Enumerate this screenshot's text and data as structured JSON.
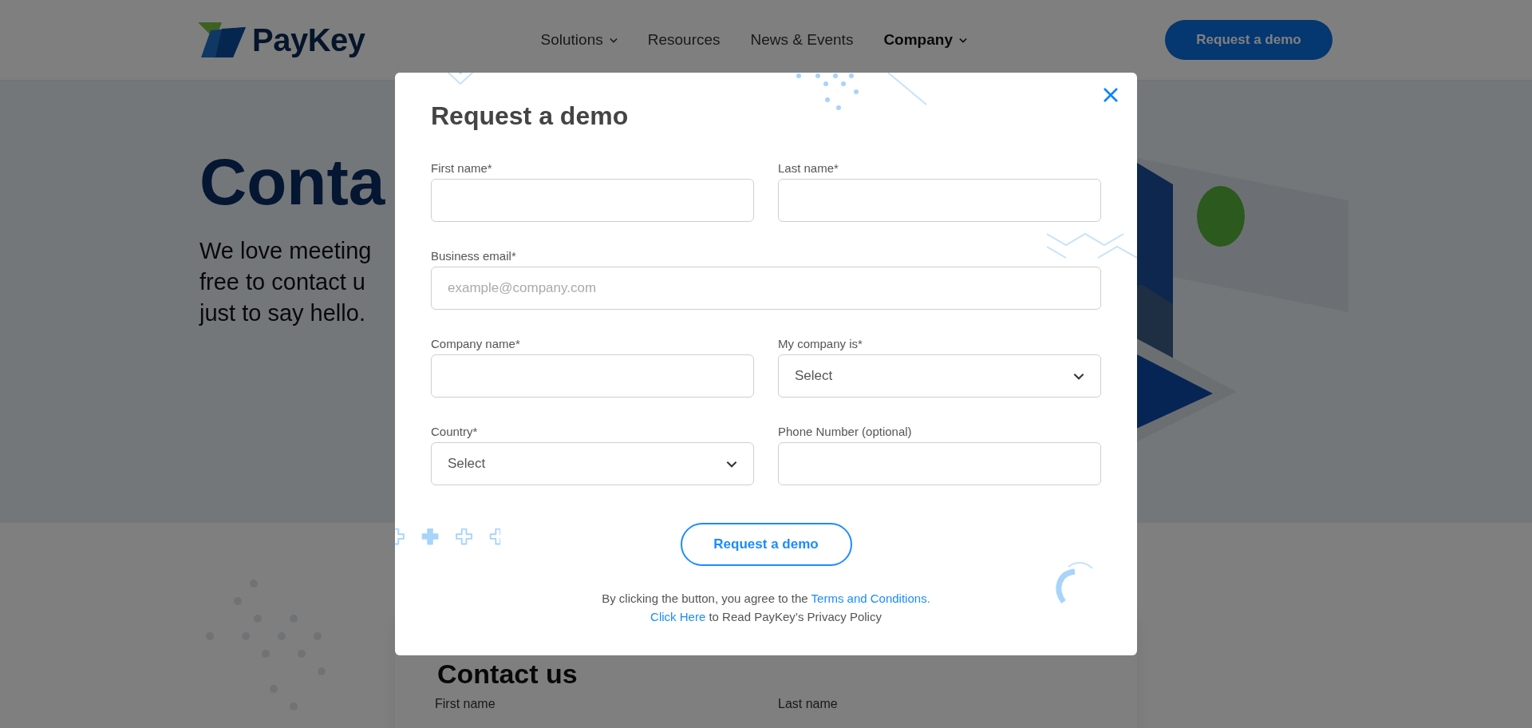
{
  "header": {
    "logo": "PayKey",
    "nav": [
      {
        "label": "Solutions",
        "dropdown": true,
        "selected": false
      },
      {
        "label": "Resources",
        "dropdown": false,
        "selected": false
      },
      {
        "label": "News & Events",
        "dropdown": false,
        "selected": false
      },
      {
        "label": "Company",
        "dropdown": true,
        "selected": true
      }
    ],
    "cta": "Request a demo"
  },
  "hero": {
    "title": "Conta",
    "lines": [
      "We love meeting",
      "free to contact u",
      "just to say hello."
    ]
  },
  "contact_section": {
    "title": "Contact us",
    "fields": [
      "First name",
      "Last name"
    ]
  },
  "modal": {
    "title": "Request a demo",
    "fields": [
      {
        "kind": "text",
        "label": "First name*"
      },
      {
        "kind": "text",
        "label": "Last name*"
      },
      {
        "kind": "email",
        "label": "Business email*",
        "placeholder": "example@company.com"
      },
      {
        "kind": "text",
        "label": "Company name*"
      },
      {
        "kind": "select",
        "label": "My company is*",
        "value": "Select"
      },
      {
        "kind": "select",
        "label": "Country*",
        "value": "Select"
      },
      {
        "kind": "text",
        "label": "Phone Number (optional)"
      }
    ],
    "submit": "Request a demo",
    "legal": [
      [
        {
          "text": "By clicking the button, you agree to the ",
          "link": false
        },
        {
          "text": "Terms and Conditions.",
          "link": true
        }
      ],
      [
        {
          "text": "Click Here",
          "link": true
        },
        {
          "text": " to Read PayKey’s Privacy Policy",
          "link": false
        }
      ]
    ]
  }
}
